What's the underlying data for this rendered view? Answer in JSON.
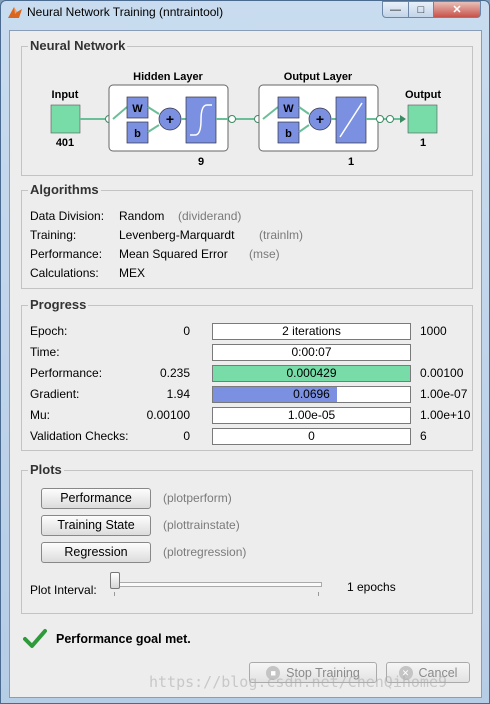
{
  "window": {
    "title": "Neural Network Training (nntraintool)",
    "min_glyph": "—",
    "max_glyph": "□",
    "close_glyph": "✕"
  },
  "network": {
    "section_title": "Neural Network",
    "input_label": "Input",
    "input_size": "401",
    "hidden_title": "Hidden Layer",
    "hidden_size": "9",
    "output_layer_title": "Output Layer",
    "output_layer_size": "1",
    "output_label": "Output",
    "output_size": "1",
    "weight_label": "W",
    "bias_label": "b",
    "sum_label": "+"
  },
  "algorithms": {
    "section_title": "Algorithms",
    "rows": [
      {
        "label": "Data Division:",
        "value": "Random",
        "fn": "(dividerand)"
      },
      {
        "label": "Training:",
        "value": "Levenberg-Marquardt",
        "fn": "(trainlm)"
      },
      {
        "label": "Performance:",
        "value": "Mean Squared Error",
        "fn": "(mse)"
      },
      {
        "label": "Calculations:",
        "value": "MEX",
        "fn": ""
      }
    ]
  },
  "progress": {
    "section_title": "Progress",
    "rows": [
      {
        "label": "Epoch:",
        "start": "0",
        "current": "2 iterations",
        "end": "1000",
        "fill": 0,
        "color": "#ffffff"
      },
      {
        "label": "Time:",
        "start": "",
        "current": "0:00:07",
        "end": "",
        "fill": 0,
        "color": "#ffffff"
      },
      {
        "label": "Performance:",
        "start": "0.235",
        "current": "0.000429",
        "end": "0.00100",
        "fill": 1.0,
        "color": "#77dca8"
      },
      {
        "label": "Gradient:",
        "start": "1.94",
        "current": "0.0696",
        "end": "1.00e-07",
        "fill": 0.63,
        "color": "#7b90e0"
      },
      {
        "label": "Mu:",
        "start": "0.00100",
        "current": "1.00e-05",
        "end": "1.00e+10",
        "fill": 0,
        "color": "#ffffff"
      },
      {
        "label": "Validation Checks:",
        "start": "0",
        "current": "0",
        "end": "6",
        "fill": 0,
        "color": "#ffffff"
      }
    ]
  },
  "plots": {
    "section_title": "Plots",
    "buttons": [
      {
        "label": "Performance",
        "fn": "(plotperform)"
      },
      {
        "label": "Training State",
        "fn": "(plottrainstate)"
      },
      {
        "label": "Regression",
        "fn": "(plotregression)"
      }
    ],
    "interval_label": "Plot Interval:",
    "interval_value": "1 epochs",
    "interval_fraction": 0.0
  },
  "status": {
    "message": "Performance goal met."
  },
  "footer": {
    "stop_label": "Stop Training",
    "cancel_label": "Cancel"
  },
  "watermark": "https://blog.csdn.net/ChenQihome9"
}
